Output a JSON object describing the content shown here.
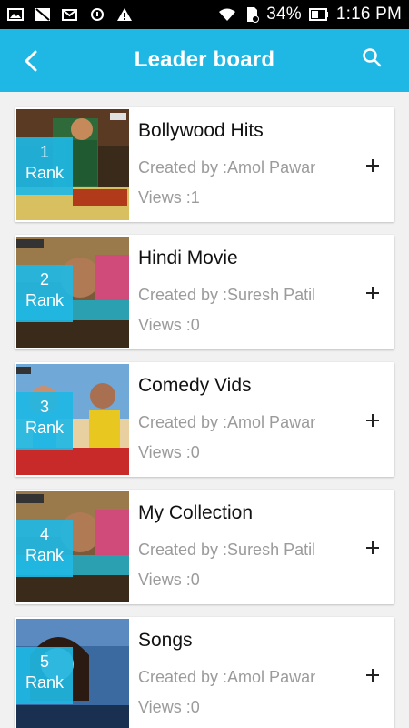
{
  "statusbar": {
    "battery": "34%",
    "time": "1:16 PM"
  },
  "appbar": {
    "title": "Leader board"
  },
  "items": [
    {
      "rank_number": "1",
      "rank_label": "Rank",
      "title": "Bollywood Hits",
      "creator": "Created by :Amol Pawar",
      "views": "Views :1"
    },
    {
      "rank_number": "2",
      "rank_label": "Rank",
      "title": "Hindi Movie",
      "creator": "Created by :Suresh Patil",
      "views": "Views :0"
    },
    {
      "rank_number": "3",
      "rank_label": "Rank",
      "title": "Comedy Vids",
      "creator": "Created by :Amol Pawar",
      "views": "Views :0"
    },
    {
      "rank_number": "4",
      "rank_label": "Rank",
      "title": "My Collection",
      "creator": "Created by :Suresh Patil",
      "views": "Views :0"
    },
    {
      "rank_number": "5",
      "rank_label": "Rank",
      "title": "Songs",
      "creator": "Created by :Amol Pawar",
      "views": "Views :0"
    }
  ],
  "colors": {
    "accent": "#1fb7e4"
  },
  "icons": {
    "back": "back-arrow-icon",
    "search": "search-icon",
    "add": "plus-icon"
  }
}
